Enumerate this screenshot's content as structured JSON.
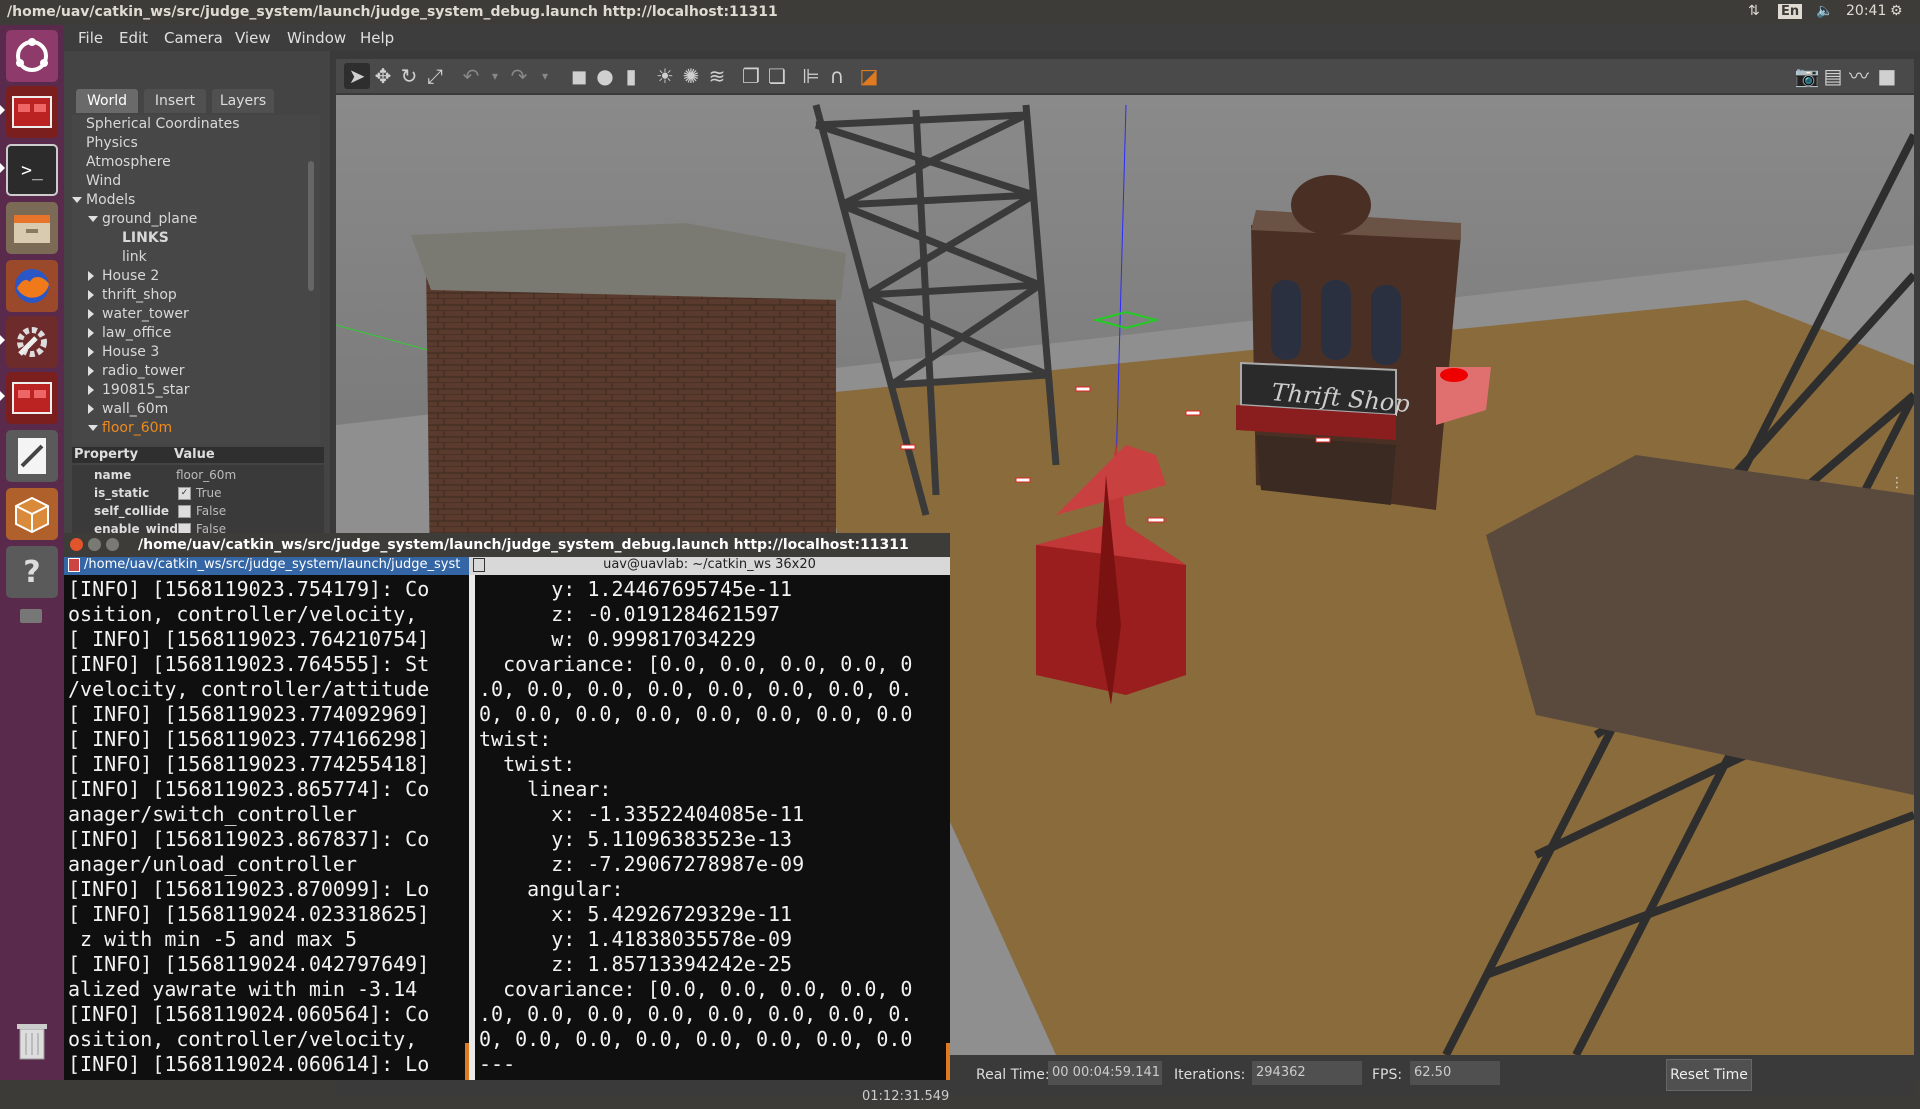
{
  "top_panel": {
    "title": "/home/uav/catkin_ws/src/judge_system/launch/judge_system_debug.launch http://localhost:11311",
    "keyboard": "En",
    "clock": "20:41"
  },
  "launcher": {
    "items": [
      "dash-icon",
      "app-icon",
      "terminal-icon",
      "files-icon",
      "firefox-icon",
      "settings-icon",
      "app-icon",
      "text-editor-icon",
      "software-icon",
      "help-icon",
      "trash-icon"
    ]
  },
  "gazebo": {
    "menu": [
      "File",
      "Edit",
      "Camera",
      "View",
      "Window",
      "Help"
    ],
    "tabs": [
      "World",
      "Insert",
      "Layers"
    ],
    "tree": [
      {
        "label": "Spherical Coordinates",
        "indent": 0,
        "arrow": "none"
      },
      {
        "label": "Physics",
        "indent": 0,
        "arrow": "none"
      },
      {
        "label": "Atmosphere",
        "indent": 0,
        "arrow": "none"
      },
      {
        "label": "Wind",
        "indent": 0,
        "arrow": "none"
      },
      {
        "label": "Models",
        "indent": 0,
        "arrow": "down"
      },
      {
        "label": "ground_plane",
        "indent": 1,
        "arrow": "down"
      },
      {
        "label": "LINKS",
        "indent": 2,
        "arrow": "none",
        "bold": true
      },
      {
        "label": "link",
        "indent": 2,
        "arrow": "none"
      },
      {
        "label": "House 2",
        "indent": 1,
        "arrow": "right"
      },
      {
        "label": "thrift_shop",
        "indent": 1,
        "arrow": "right"
      },
      {
        "label": "water_tower",
        "indent": 1,
        "arrow": "right"
      },
      {
        "label": "law_office",
        "indent": 1,
        "arrow": "right"
      },
      {
        "label": "House 3",
        "indent": 1,
        "arrow": "right"
      },
      {
        "label": "radio_tower",
        "indent": 1,
        "arrow": "right"
      },
      {
        "label": "190815_star",
        "indent": 1,
        "arrow": "right"
      },
      {
        "label": "wall_60m",
        "indent": 1,
        "arrow": "right"
      },
      {
        "label": "floor_60m",
        "indent": 1,
        "arrow": "down",
        "selected": true
      }
    ],
    "properties": {
      "header_property": "Property",
      "header_value": "Value",
      "rows": [
        {
          "key": "name",
          "value": "floor_60m",
          "checkbox": false
        },
        {
          "key": "is_static",
          "value": "True",
          "checkbox": true,
          "checked": true
        },
        {
          "key": "self_collide",
          "value": "False",
          "checkbox": true,
          "checked": false
        },
        {
          "key": "enable_wind",
          "value": "False",
          "checkbox": true,
          "checked": false
        }
      ]
    },
    "scene": {
      "sign_text": "Thrift Shop",
      "sky_color": "#6e6e6e",
      "ground_color": "#8a6b3c",
      "star_color": "#b02a2a"
    },
    "bottom": {
      "sim_time_value": "00 01:12:31.549",
      "real_time_label": "Real Time:",
      "real_time_value": "00 00:04:59.141",
      "iterations_label": "Iterations:",
      "iterations_value": "294362",
      "fps_label": "FPS:",
      "fps_value": "62.50",
      "reset_label": "Reset Time"
    }
  },
  "terminal": {
    "title": "/home/uav/catkin_ws/src/judge_system/launch/judge_system_debug.launch http://localhost:11311",
    "tab1": "/home/uav/catkin_ws/src/judge_system/launch/judge_syst",
    "tab2": "uav@uavlab: ~/catkin_ws 36x20",
    "left_lines": [
      "[INFO] [1568119023.754179]: Co",
      "osition, controller/velocity,",
      "[ INFO] [1568119023.764210754]",
      "[INFO] [1568119023.764555]: St",
      "/velocity, controller/attitude",
      "[ INFO] [1568119023.774092969]",
      "[ INFO] [1568119023.774166298]",
      "[ INFO] [1568119023.774255418]",
      "[INFO] [1568119023.865774]: Co",
      "anager/switch_controller",
      "[INFO] [1568119023.867837]: Co",
      "anager/unload_controller",
      "[INFO] [1568119023.870099]: Lo",
      "[ INFO] [1568119024.023318625]",
      " z with min -5 and max 5",
      "[ INFO] [1568119024.042797649]",
      "alized yawrate with min -3.14",
      "[INFO] [1568119024.060564]: Co",
      "osition, controller/velocity,",
      "[INFO] [1568119024.060614]: Lo"
    ],
    "right_lines": [
      "      y: 1.24467695745e-11",
      "      z: -0.0191284621597",
      "      w: 0.999817034229",
      "  covariance: [0.0, 0.0, 0.0, 0.0, 0",
      ".0, 0.0, 0.0, 0.0, 0.0, 0.0, 0.0, 0.",
      "0, 0.0, 0.0, 0.0, 0.0, 0.0, 0.0, 0.0",
      "twist:",
      "  twist:",
      "    linear:",
      "      x: -1.33522404085e-11",
      "      y: 5.11096383523e-13",
      "      z: -7.29067278987e-09",
      "    angular:",
      "      x: 5.42926729329e-11",
      "      y: 1.41838035578e-09",
      "      z: 1.85713394242e-25",
      "  covariance: [0.0, 0.0, 0.0, 0.0, 0",
      ".0, 0.0, 0.0, 0.0, 0.0, 0.0, 0.0, 0.",
      "0, 0.0, 0.0, 0.0, 0.0, 0.0, 0.0, 0.0",
      "---"
    ]
  }
}
